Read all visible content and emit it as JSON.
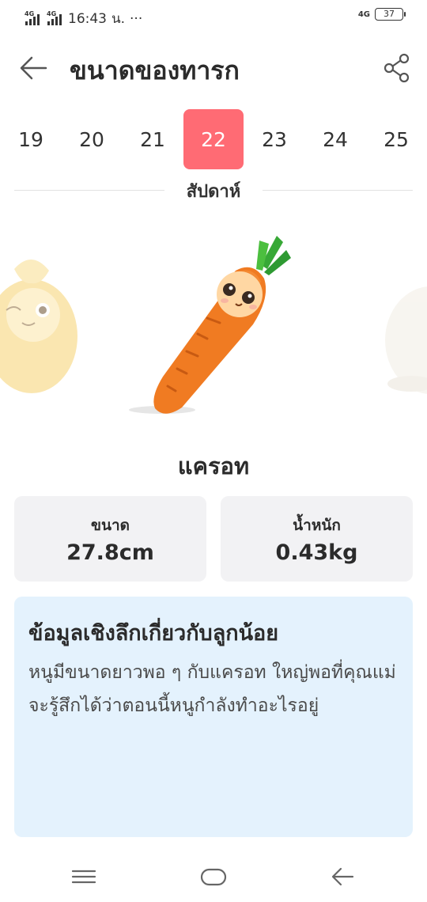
{
  "status_bar": {
    "time": "16:43",
    "carrier_mark": "น.",
    "more": "···",
    "signal_1": "4G",
    "signal_2": "4G",
    "right_network": "4G",
    "battery": "37"
  },
  "header": {
    "title": "ขนาดของทารก",
    "back_icon": "arrow-left-icon",
    "share_icon": "share-icon"
  },
  "weeks": {
    "items": [
      "19",
      "20",
      "21",
      "22",
      "23",
      "24",
      "25"
    ],
    "selected": "22",
    "unit_label": "สัปดาห์",
    "active_color": "#ff6b74"
  },
  "fruit": {
    "name": "แครอท",
    "size_label": "ขนาด",
    "size_value": "27.8cm",
    "weight_label": "น้ำหนัก",
    "weight_value": "0.43kg"
  },
  "insight": {
    "title": "ข้อมูลเชิงลึกเกี่ยวกับลูกน้อย",
    "body": "หนูมีขนาดยาวพอ ๆ กับแครอท ใหญ่พอที่คุณแม่จะรู้สึกได้ว่าตอนนี้หนูกำลังทำอะไรอยู่",
    "background": "#e4f2fd"
  },
  "nav": {
    "menu_icon": "menu-icon",
    "home_icon": "home-icon",
    "back_icon": "back-icon"
  }
}
